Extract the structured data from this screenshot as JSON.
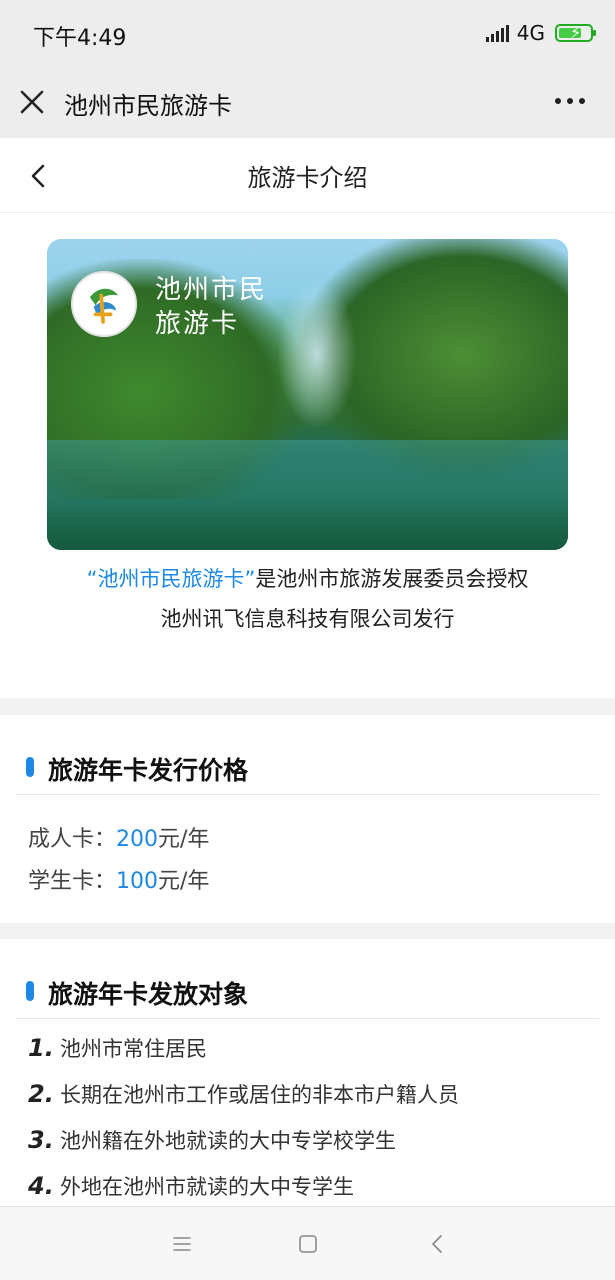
{
  "status": {
    "time": "下午4:49",
    "network": "4G"
  },
  "appbar": {
    "title": "池州市民旅游卡"
  },
  "nav": {
    "title": "旅游卡介绍"
  },
  "card": {
    "line1": "池州市民",
    "line2": "旅游卡"
  },
  "intro": {
    "quoted": "“池州市民旅游卡”",
    "rest1": "是池州市旅游发展委员会授权",
    "line2": "池州讯飞信息科技有限公司发行"
  },
  "price_section": {
    "title": "旅游年卡发行价格",
    "items": [
      {
        "label": "成人卡：",
        "value": "200",
        "unit": "元/年"
      },
      {
        "label": "学生卡：",
        "value": "100",
        "unit": "元/年"
      }
    ]
  },
  "target_section": {
    "title": "旅游年卡发放对象",
    "items": [
      {
        "idx": "1.",
        "text": "池州市常住居民"
      },
      {
        "idx": "2.",
        "text": "长期在池州市工作或居住的非本市户籍人员"
      },
      {
        "idx": "3.",
        "text": "池州籍在外地就读的大中专学校学生"
      },
      {
        "idx": "4.",
        "text": "外地在池州市就读的大中专学生"
      }
    ]
  },
  "colors": {
    "accent": "#1e88e5",
    "battery": "#44cc44"
  },
  "icons": [
    "close-icon",
    "more-icon",
    "back-icon",
    "menu-icon",
    "home-icon",
    "back-nav-icon"
  ]
}
